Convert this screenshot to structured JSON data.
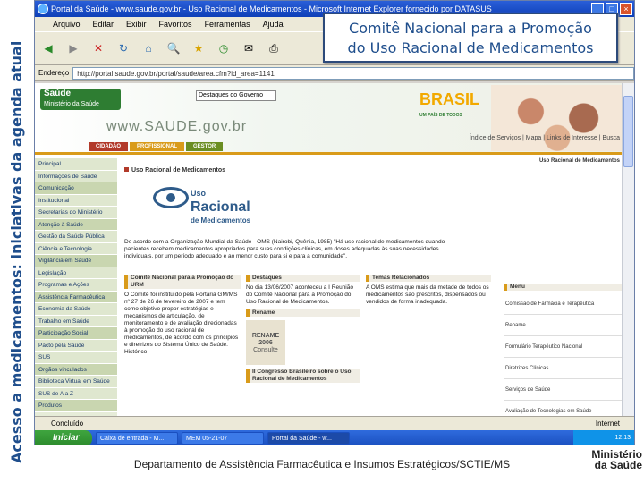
{
  "slide": {
    "vertical_title": "Acesso a medicamentos: iniciativas da agenda atual",
    "callout": [
      "Comitê Nacional para a Promoção",
      "do Uso Racional de Medicamentos"
    ],
    "footer": "Departamento de Assistência Farmacêutica e Insumos Estratégicos/SCTIE/MS",
    "ministry_logo": [
      "Ministério",
      "da Saúde"
    ]
  },
  "browser": {
    "title": "Portal da Saúde - www.saude.gov.br - Uso Racional de Medicamentos - Microsoft Internet Explorer fornecido por DATASUS",
    "menu": [
      "Arquivo",
      "Editar",
      "Exibir",
      "Favoritos",
      "Ferramentas",
      "Ajuda"
    ],
    "address_label": "Endereço",
    "address_value": "http://portal.saude.gov.br/portal/saude/area.cfm?id_area=1141",
    "status": "Concluído",
    "zone": "Internet"
  },
  "site": {
    "logo": [
      "Saúde",
      "Ministério da Saúde"
    ],
    "destaques_select": "Destaques do Governo",
    "brasil_logo": "BRASIL",
    "brasil_tagline": "UM PAÍS DE TODOS",
    "url_text": "www.SAUDE.gov.br",
    "tabs": [
      "CIDADÃO",
      "PROFISSIONAL",
      "GESTOR"
    ],
    "topnav": "Índice de Serviços | Mapa | Links de Interesse | Busca",
    "crumb": "Uso Racional de Medicamentos",
    "left_nav": [
      "Principal",
      "Informações de Saúde",
      "Comunicação",
      "Institucional",
      "Secretarias do Ministério",
      "Atenção à Saúde",
      "Gestão da Saúde Pública",
      "Ciência e Tecnologia",
      "Vigilância em Saúde",
      "Legislação",
      "Programas e Ações",
      "Assistência Farmacêutica",
      "Economia da Saúde",
      "Trabalho em Saúde",
      "Participação Social",
      "Pacto pela Saúde",
      "SUS",
      "Orgãos vinculados",
      "Biblioteca Virtual em Saúde",
      "SUS de A a Z",
      "Produtos"
    ],
    "content_title": "Uso Racional de Medicamentos",
    "urm_logo": [
      "Uso",
      "Racional",
      "de Medicamentos"
    ],
    "intro": "De acordo com a Organização Mundial da Saúde - OMS (Nairobi, Quênia, 1985) \"Há uso racional de medicamentos quando pacientes recebem medicamentos apropriados para suas condições clínicas, em doses adequadas às suas necessidades individuais, por um período adequado e ao menor custo para si e para a comunidade\".",
    "col1_title": "Comitê Nacional para a Promoção do URM",
    "col1_text": "O Comitê foi instituído pela Portaria GM/MS nº 27 de 26 de fevereiro de 2007 e tem como objetivo propor estratégias e mecanismos de articulação, de monitoramento e de avaliação direcionadas à promoção do uso racional de medicamentos, de acordo com os princípios e diretrizes do Sistema Único de Saúde. Histórico",
    "col2_title": "Destaques",
    "col2_text": "No dia 13/06/2007 aconteceu a I Reunião do Comitê Nacional para a Promoção do Uso Racional de Medicamentos.",
    "col2_sub": "Rename",
    "rename_box": [
      "RENAME",
      "2006",
      "Consulte"
    ],
    "col2_more": "II Congresso Brasileiro sobre o Uso Racional de Medicamentos",
    "col3_title": "Temas Relacionados",
    "col3_text": "A OMS estima que mais da metade de todos os medicamentos são prescritos, dispensados ou vendidos de forma inadequada.",
    "right_links_title": "Menu",
    "right_links": [
      "Comissão de Farmácia e Terapêutica",
      "Rename",
      "Formulário Terapêutico Nacional",
      "Diretrizes Clínicas",
      "Serviços de Saúde",
      "Avaliação de Tecnologias em Saúde"
    ]
  },
  "taskbar": {
    "start": "Iniciar",
    "tasks": [
      "Caixa de entrada - M...",
      "MEM 05-21-07",
      "Portal da Saúde - w..."
    ],
    "clock": "12:13"
  }
}
